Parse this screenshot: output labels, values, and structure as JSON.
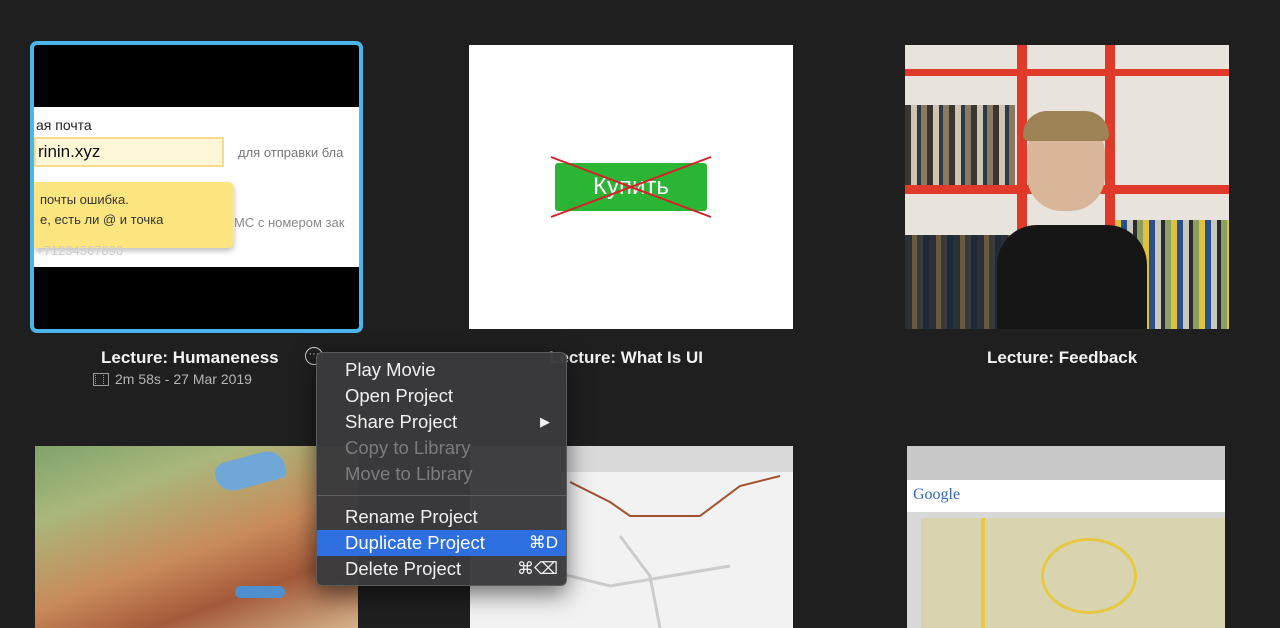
{
  "projects": [
    {
      "title": "Lecture: Humaneness",
      "meta": "2m 58s - 27 Mar 2019",
      "thumb": {
        "label": "ая почта",
        "input_value": "rinin.xyz",
        "hint": "для отправки бла",
        "tooltip_line1": "почты ошибка.",
        "tooltip_line2": "е, есть ли @ и точка",
        "sms": "МС с номером зак",
        "number": "+71234567890"
      }
    },
    {
      "title": "Lecture: What Is UI",
      "thumb": {
        "button_label": "Купить"
      }
    },
    {
      "title": "Lecture: Feedback"
    }
  ],
  "context_menu": {
    "items": [
      {
        "label": "Play Movie",
        "enabled": true
      },
      {
        "label": "Open Project",
        "enabled": true
      },
      {
        "label": "Share Project",
        "enabled": true,
        "submenu": "▶"
      },
      {
        "label": "Copy to Library",
        "enabled": false
      },
      {
        "label": "Move to Library",
        "enabled": false
      }
    ],
    "items2": [
      {
        "label": "Rename Project",
        "enabled": true
      },
      {
        "label": "Duplicate Project",
        "enabled": true,
        "shortcut": "⌘D",
        "highlighted": true
      },
      {
        "label": "Delete Project",
        "enabled": true,
        "shortcut": "⌘⌫"
      }
    ]
  },
  "colors": {
    "selection": "#4cb6ec",
    "menu_highlight": "#2d6fe1",
    "buy_green": "#2bb534"
  },
  "bottom_thumbs": {
    "google_logo": "Google"
  }
}
